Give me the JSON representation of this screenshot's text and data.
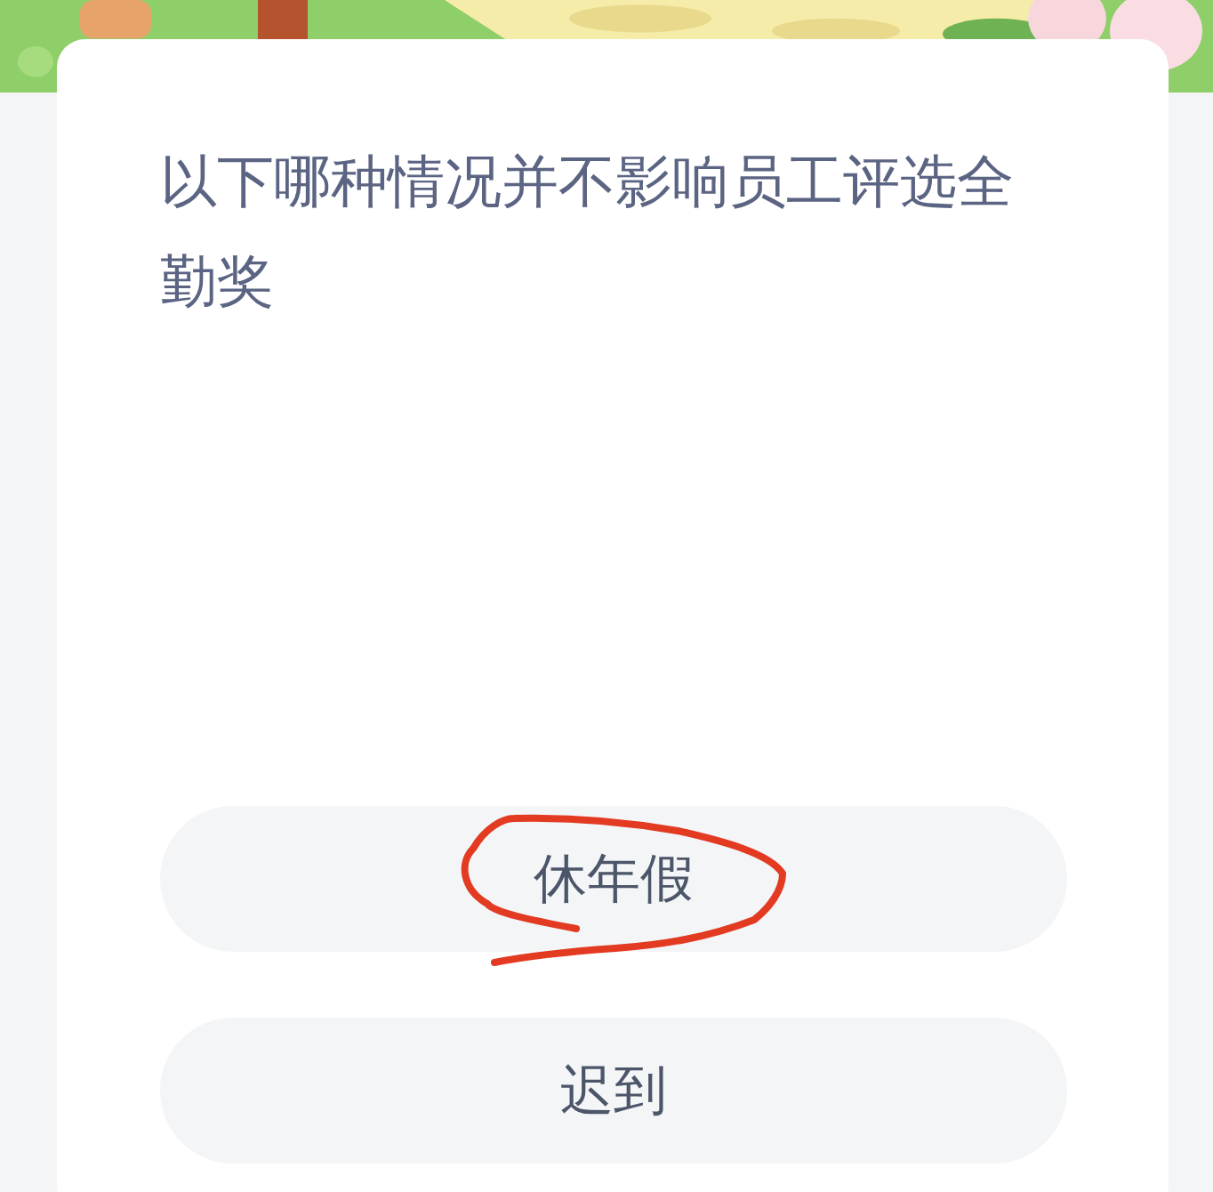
{
  "question": "以下哪种情况并不影响员工评选全勤奖",
  "options": [
    {
      "label": "休年假",
      "circled": true
    },
    {
      "label": "迟到",
      "circled": false
    }
  ]
}
